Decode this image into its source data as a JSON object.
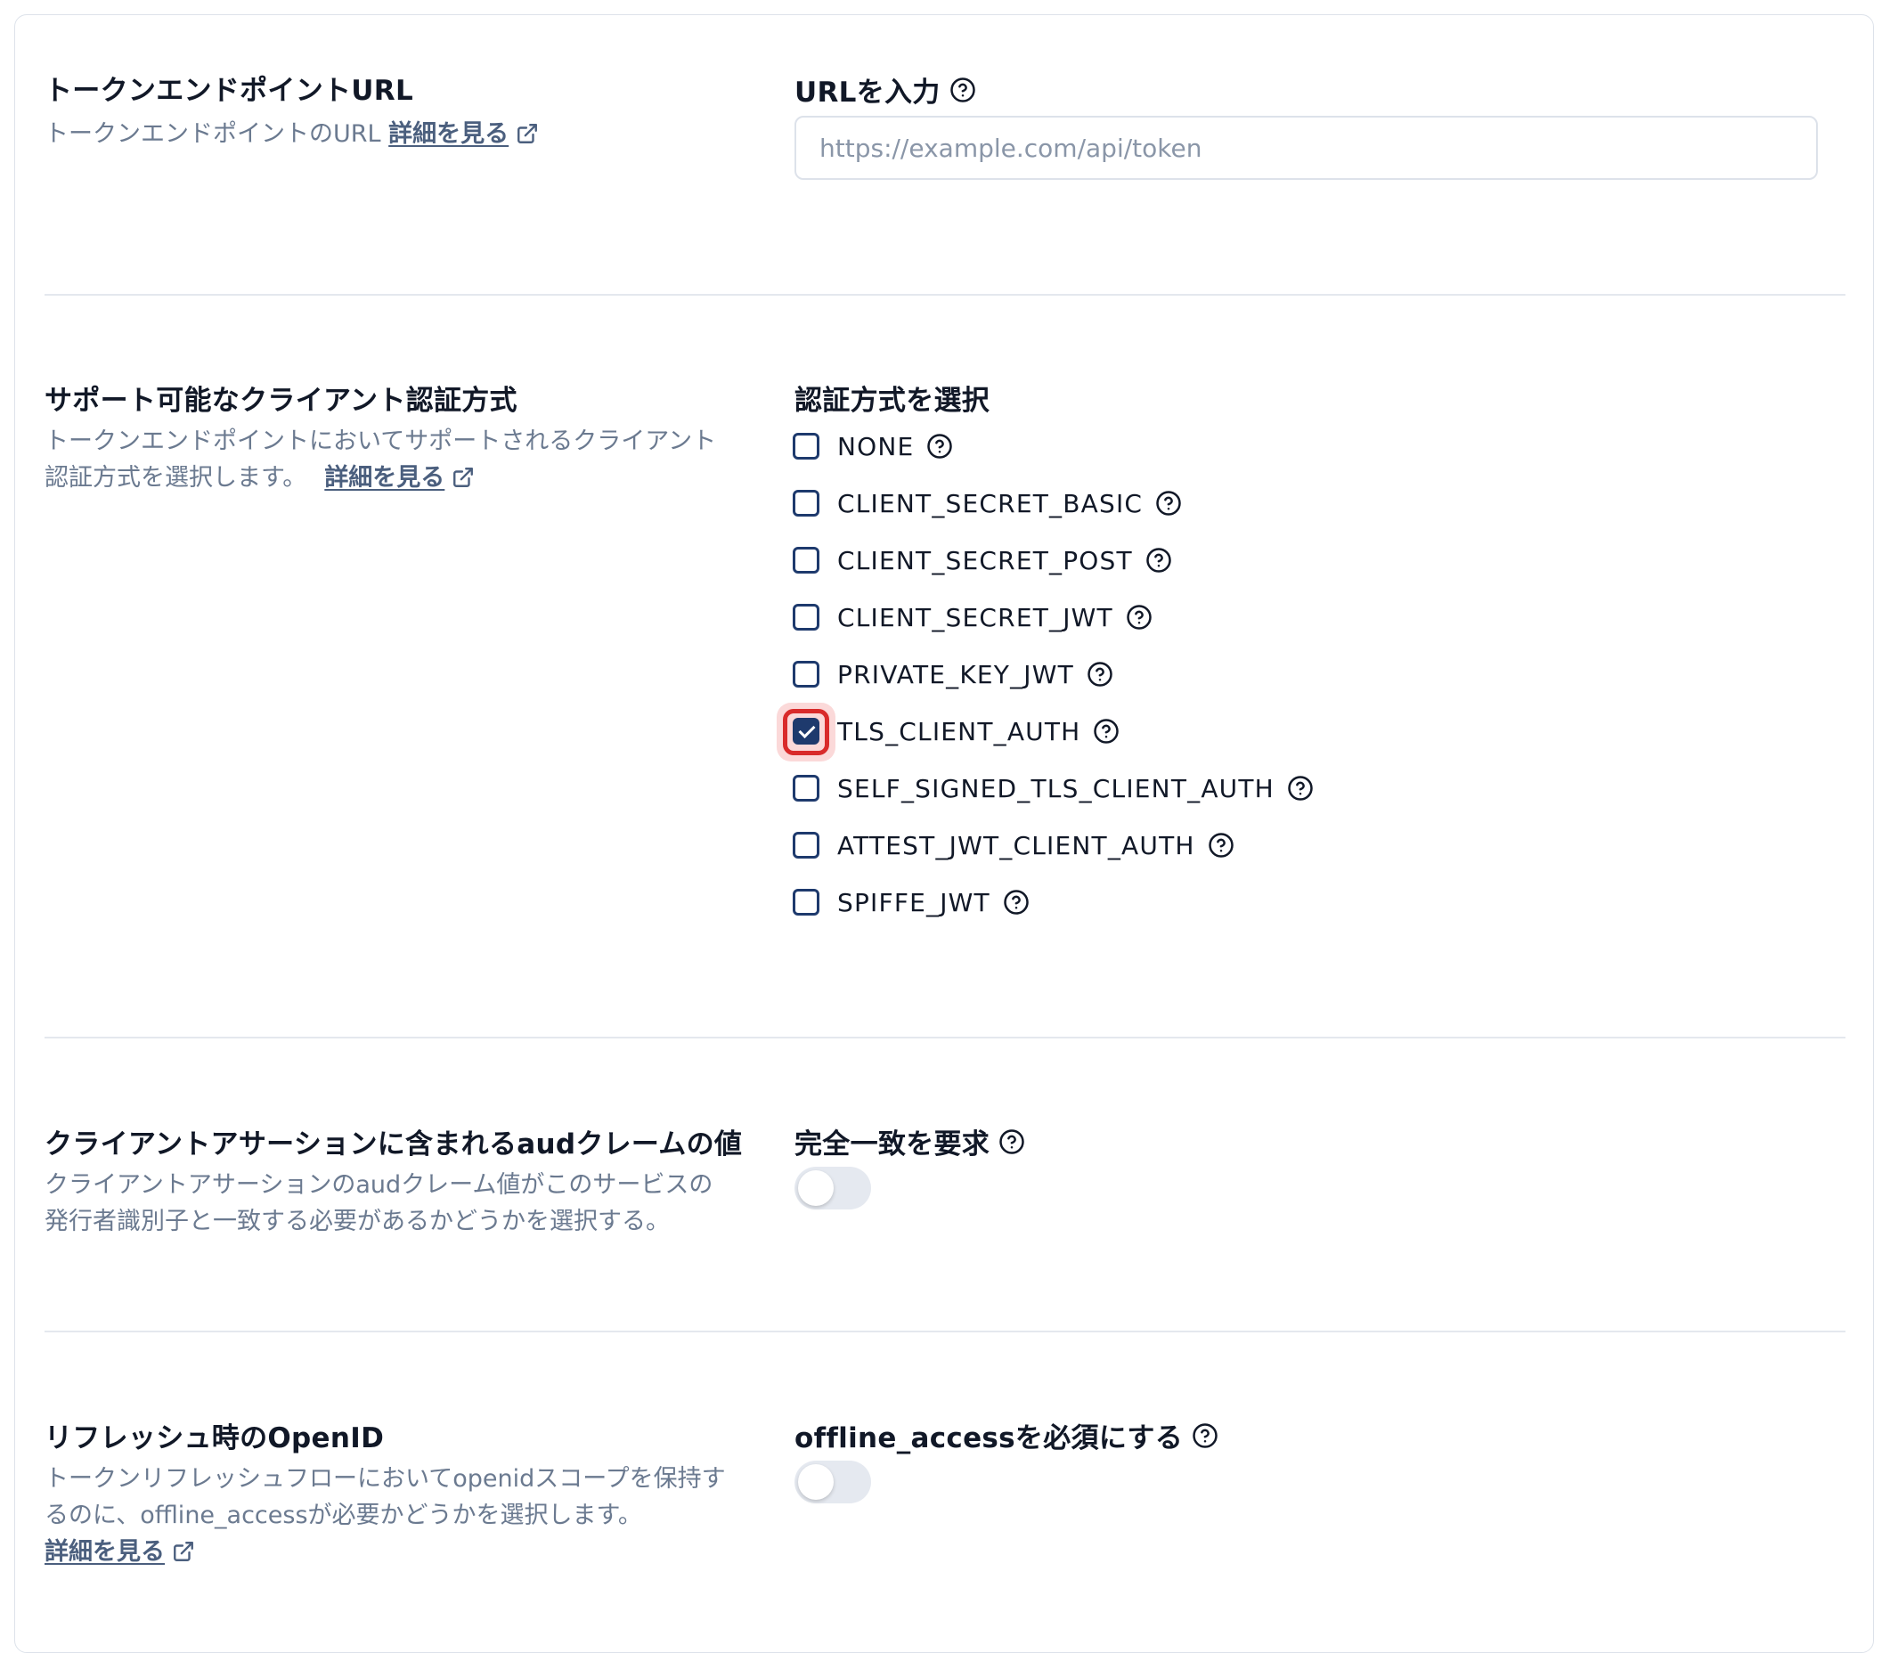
{
  "token_endpoint": {
    "title": "トークンエンドポイントURL",
    "description": "トークンエンドポイントのURL",
    "learn_more": "詳細を見る",
    "field_label": "URLを入力",
    "input_placeholder": "https://example.com/api/token",
    "input_value": ""
  },
  "auth_methods": {
    "title": "サポート可能なクライアント認証方式",
    "description_line1": "トークンエンドポイントにおいてサポートされるクライアント",
    "description_line2": "認証方式を選択します。",
    "learn_more": "詳細を見る",
    "field_label": "認証方式を選択",
    "options": [
      {
        "label": "NONE",
        "checked": false
      },
      {
        "label": "CLIENT_SECRET_BASIC",
        "checked": false
      },
      {
        "label": "CLIENT_SECRET_POST",
        "checked": false
      },
      {
        "label": "CLIENT_SECRET_JWT",
        "checked": false
      },
      {
        "label": "PRIVATE_KEY_JWT",
        "checked": false
      },
      {
        "label": "TLS_CLIENT_AUTH",
        "checked": true
      },
      {
        "label": "SELF_SIGNED_TLS_CLIENT_AUTH",
        "checked": false
      },
      {
        "label": "ATTEST_JWT_CLIENT_AUTH",
        "checked": false
      },
      {
        "label": "SPIFFE_JWT",
        "checked": false
      }
    ]
  },
  "aud_claim": {
    "title": "クライアントアサーションに含まれるaudクレームの値",
    "description_line1": "クライアントアサーションのaudクレーム値がこのサービスの",
    "description_line2": "発行者識別子と一致する必要があるかどうかを選択する。",
    "field_label": "完全一致を要求",
    "toggle_on": false
  },
  "refresh_openid": {
    "title": "リフレッシュ時のOpenID",
    "description_line1": "トークンリフレッシュフローにおいてopenidスコープを保持す",
    "description_line2": "るのに、offline_accessが必要かどうかを選択します。",
    "learn_more": "詳細を見る",
    "field_label": "offline_accessを必須にする",
    "toggle_on": false
  },
  "icons": {
    "help": "question-circle-icon",
    "external_link": "external-link-icon",
    "check": "check-icon"
  },
  "colors": {
    "accent": "#1e3a6d",
    "muted_text": "#6b7a90",
    "focus_ring": "#d92b2b"
  }
}
